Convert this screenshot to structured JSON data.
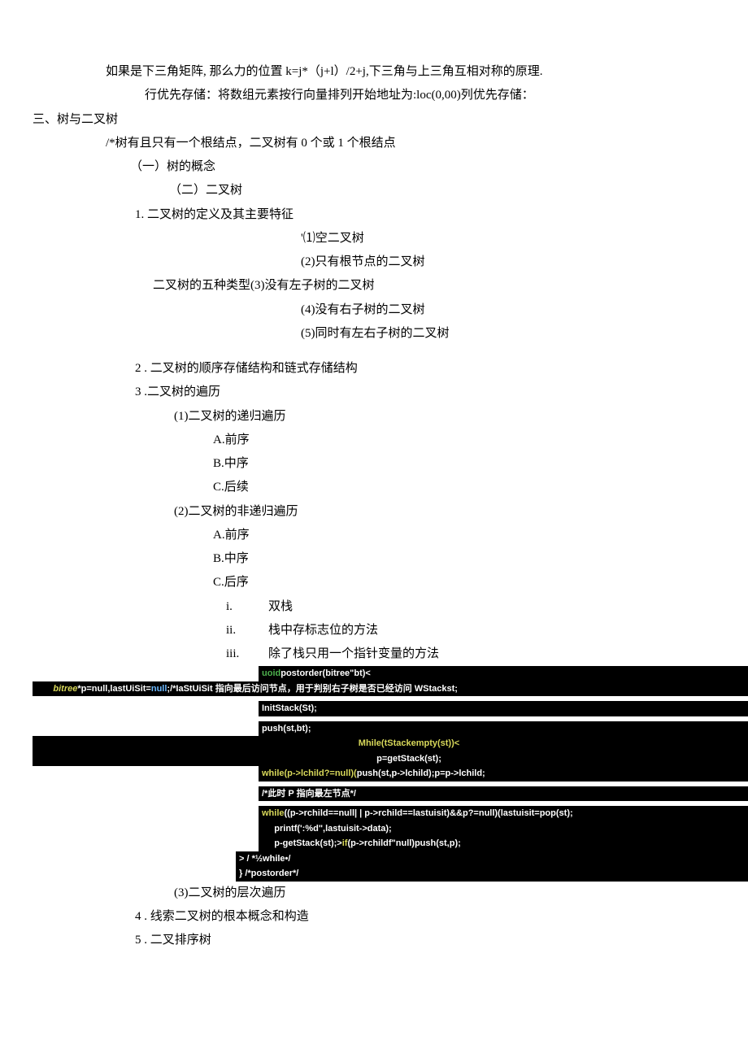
{
  "p1": "如果是下三角矩阵, 那么力的位置 k=j*（j+l）/2+j,下三角与上三角互相对称的原理.",
  "p2": "行优先存储：将数组元素按行向量排列开始地址为:loc(0,00)列优先存储：",
  "section3": "三、树与二叉树",
  "note": "/*树有且只有一个根结点，二叉树有 0 个或 1 个根结点",
  "h1": "（一）树的概念",
  "h2": "（二）二叉树",
  "i1": "1. 二叉树的定义及其主要特征",
  "typesLabel": "二叉树的五种类型",
  "types": {
    "t1": "'⑴空二叉树",
    "t2": "(2)只有根节点的二叉树",
    "t3": "(3)没有左子树的二叉树",
    "t4": "(4)没有右子树的二叉树",
    "t5": "(5)同时有左右子树的二叉树"
  },
  "i2": "2  . 二叉树的顺序存储结构和链式存储结构",
  "i3": "3  .二叉树的遍历",
  "i3_1": "(1)二叉树的递归遍历",
  "i3_1a": "A.前序",
  "i3_1b": "B.中序",
  "i3_1c": "C.后续",
  "i3_2": "(2)二叉树的非递归遍历",
  "i3_2a": "A.前序",
  "i3_2b": "B.中序",
  "i3_2c": "C.后序",
  "r1": "双栈",
  "r2": "栈中存标志位的方法",
  "r3": "除了栈只用一个指针变量的方法",
  "code": {
    "l1a": "uoid",
    "l1b": "postorder(bitree\"bt)<",
    "l2a": "bitree",
    "l2b": "*p=null,lastUiSit=",
    "l2c": "null",
    "l2d": ";/*IaStUiSit 指向最后访问节点，用于判别右子树是否已经访问 WStackst;",
    "l3": "InitStack(St);",
    "l4": "push(st,bt);",
    "l5": "Mhile(tStackempty(st))<",
    "l6": "p=getStack(st);",
    "l7a": "while(p->lchild?=null)(",
    "l7b": "push(st,p->lchild);p=p->lchild;",
    "l8": "/*此时 P 指向最左节点*/",
    "l9a": "while",
    "l9b": "((p->rchild==null| | p->rchild==lastuisit)&&p?=null)(lastuisit=pop(st);",
    "l10": "printf(':%d\",lastuisit->data);",
    "l11a": "p-getStack(st);>",
    "l11b": "if",
    "l11c": "(p->rchildf\"null)push(st,p);",
    "l12": "> / *½while•/",
    "l13": "} /*postorder*/"
  },
  "i3_3": "(3)二叉树的层次遍历",
  "i4": "4  . 线索二叉树的根本概念和构造",
  "i5": "5  . 二叉排序树"
}
